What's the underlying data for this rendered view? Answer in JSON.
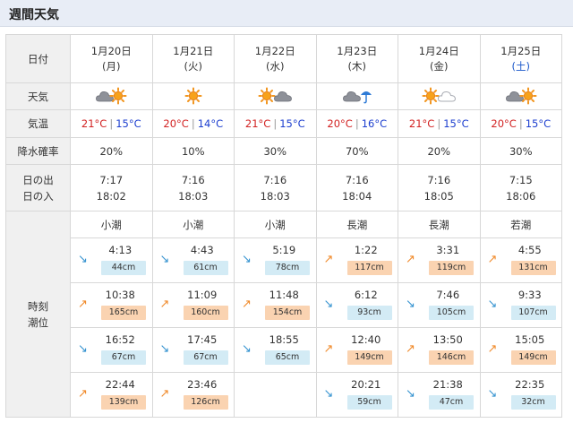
{
  "header": {
    "title": "週間天気"
  },
  "labels": {
    "date": "日付",
    "weather": "天気",
    "temp": "気温",
    "rain": "降水確率",
    "sunrise": "日の出",
    "sunset": "日の入",
    "tide_time": "時刻",
    "tide_level": "潮位"
  },
  "days": [
    {
      "date": "1月20日",
      "weekday": "(月)",
      "weekday_type": "weekday",
      "weather": [
        "cloud-icon",
        "sun-icon"
      ],
      "high": "21°C",
      "low": "15°C",
      "rain": "20%",
      "sunrise": "7:17",
      "sunset": "18:02",
      "tide_name": "小潮",
      "tides": [
        {
          "time": "4:13",
          "level": "44cm",
          "dir": "down"
        },
        {
          "time": "10:38",
          "level": "165cm",
          "dir": "up"
        },
        {
          "time": "16:52",
          "level": "67cm",
          "dir": "down"
        },
        {
          "time": "22:44",
          "level": "139cm",
          "dir": "up"
        }
      ]
    },
    {
      "date": "1月21日",
      "weekday": "(火)",
      "weekday_type": "weekday",
      "weather": [
        "sun-icon"
      ],
      "high": "20°C",
      "low": "14°C",
      "rain": "10%",
      "sunrise": "7:16",
      "sunset": "18:03",
      "tide_name": "小潮",
      "tides": [
        {
          "time": "4:43",
          "level": "61cm",
          "dir": "down"
        },
        {
          "time": "11:09",
          "level": "160cm",
          "dir": "up"
        },
        {
          "time": "17:45",
          "level": "67cm",
          "dir": "down"
        },
        {
          "time": "23:46",
          "level": "126cm",
          "dir": "up"
        }
      ]
    },
    {
      "date": "1月22日",
      "weekday": "(水)",
      "weekday_type": "weekday",
      "weather": [
        "sun-icon",
        "cloud-icon"
      ],
      "high": "21°C",
      "low": "15°C",
      "rain": "30%",
      "sunrise": "7:16",
      "sunset": "18:03",
      "tide_name": "小潮",
      "tides": [
        {
          "time": "5:19",
          "level": "78cm",
          "dir": "down"
        },
        {
          "time": "11:48",
          "level": "154cm",
          "dir": "up"
        },
        {
          "time": "18:55",
          "level": "65cm",
          "dir": "down"
        }
      ]
    },
    {
      "date": "1月23日",
      "weekday": "(木)",
      "weekday_type": "weekday",
      "weather": [
        "cloud-icon",
        "umbrella-icon"
      ],
      "high": "20°C",
      "low": "16°C",
      "rain": "70%",
      "sunrise": "7:16",
      "sunset": "18:04",
      "tide_name": "長潮",
      "tides": [
        {
          "time": "1:22",
          "level": "117cm",
          "dir": "up"
        },
        {
          "time": "6:12",
          "level": "93cm",
          "dir": "down"
        },
        {
          "time": "12:40",
          "level": "149cm",
          "dir": "up"
        },
        {
          "time": "20:21",
          "level": "59cm",
          "dir": "down"
        }
      ]
    },
    {
      "date": "1月24日",
      "weekday": "(金)",
      "weekday_type": "weekday",
      "weather": [
        "sun-icon",
        "white-cloud-icon"
      ],
      "high": "21°C",
      "low": "15°C",
      "rain": "20%",
      "sunrise": "7:16",
      "sunset": "18:05",
      "tide_name": "長潮",
      "tides": [
        {
          "time": "3:31",
          "level": "119cm",
          "dir": "up"
        },
        {
          "time": "7:46",
          "level": "105cm",
          "dir": "down"
        },
        {
          "time": "13:50",
          "level": "146cm",
          "dir": "up"
        },
        {
          "time": "21:38",
          "level": "47cm",
          "dir": "down"
        }
      ]
    },
    {
      "date": "1月25日",
      "weekday": "(土)",
      "weekday_type": "saturday",
      "weather": [
        "cloud-icon",
        "sun-icon"
      ],
      "high": "20°C",
      "low": "15°C",
      "rain": "30%",
      "sunrise": "7:15",
      "sunset": "18:06",
      "tide_name": "若潮",
      "tides": [
        {
          "time": "4:55",
          "level": "131cm",
          "dir": "up"
        },
        {
          "time": "9:33",
          "level": "107cm",
          "dir": "down"
        },
        {
          "time": "15:05",
          "level": "149cm",
          "dir": "up"
        },
        {
          "time": "22:35",
          "level": "32cm",
          "dir": "down"
        }
      ]
    }
  ],
  "colors": {
    "high_temp": "#d22222",
    "low_temp": "#1d3fcf",
    "saturday": "#1a57c9",
    "rising_arrow": "#f08a2a",
    "falling_arrow": "#3593d0",
    "high_tide_badge": "#fad3b1",
    "low_tide_badge": "#d3ebf5"
  },
  "icons": {
    "rising": "↗",
    "falling": "↘"
  }
}
